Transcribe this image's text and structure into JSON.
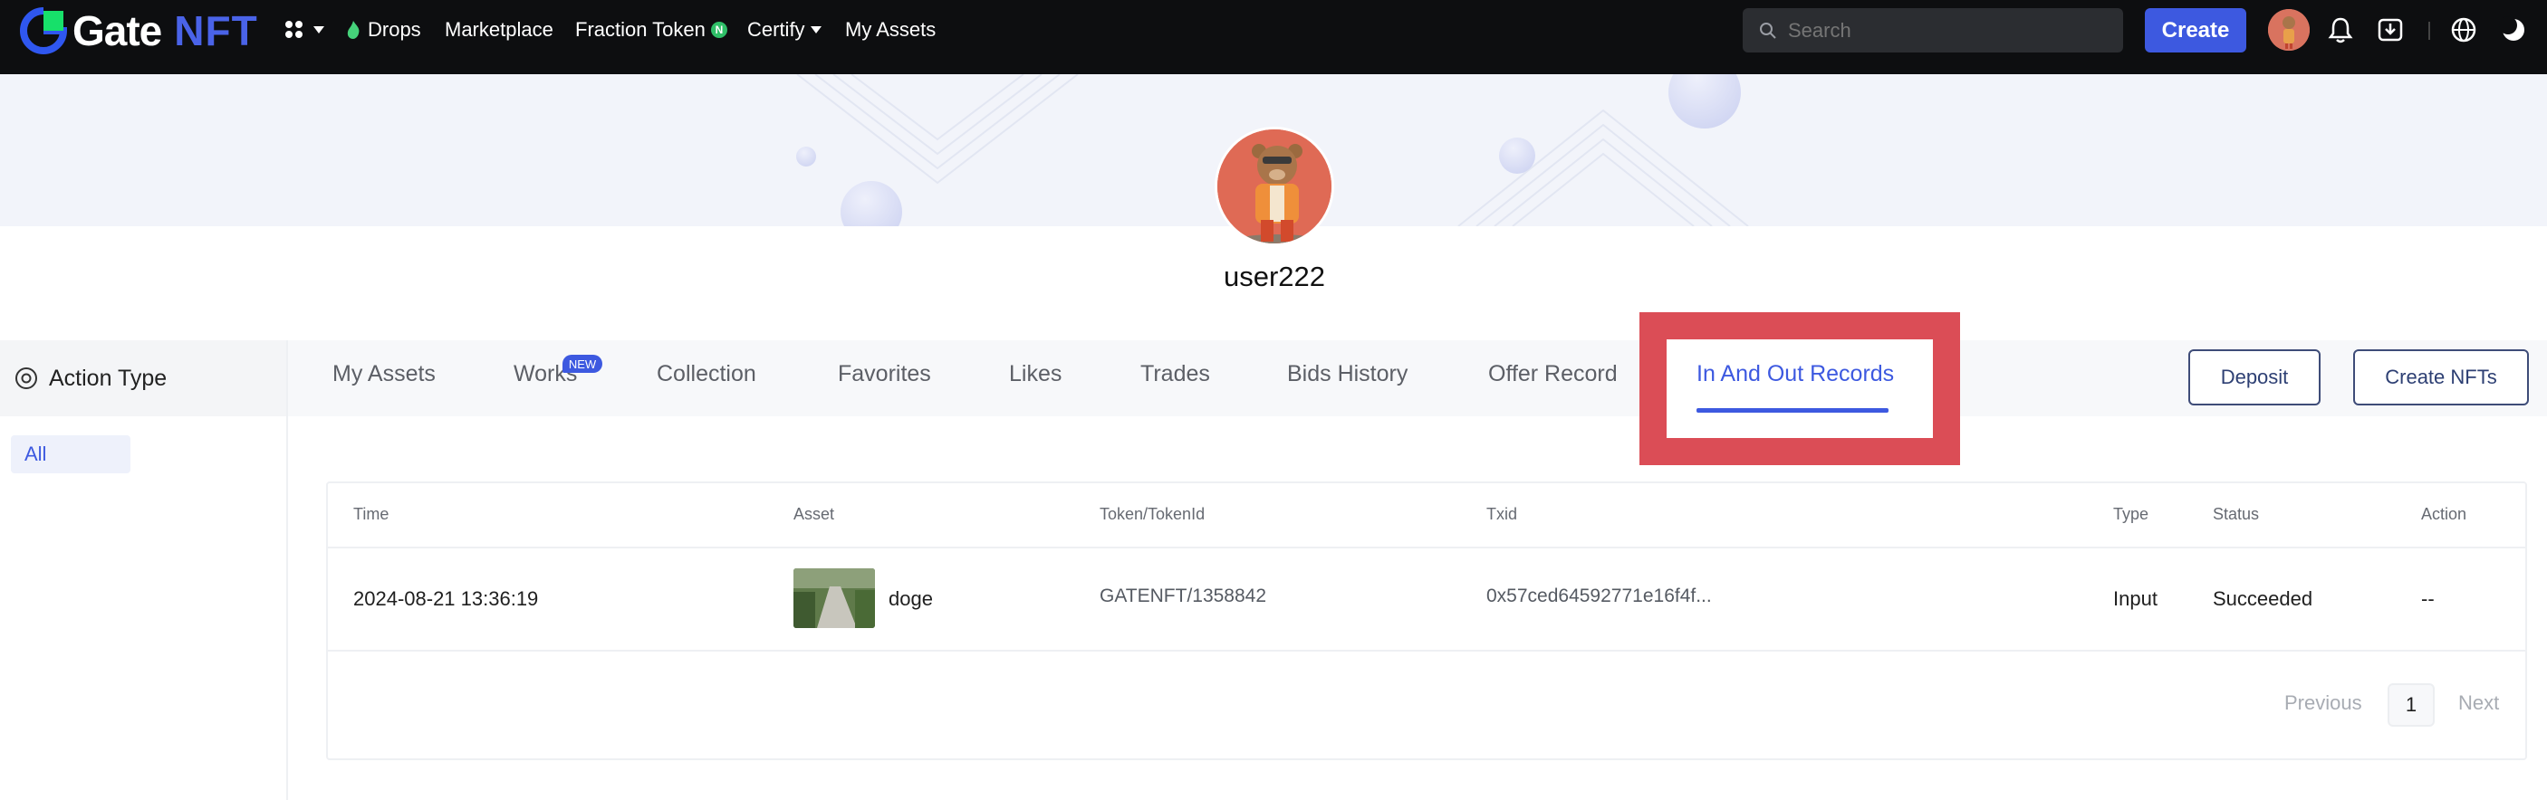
{
  "brand": {
    "name_part1": "Gate",
    "name_part2": "NFT"
  },
  "nav": {
    "drops": "Drops",
    "marketplace": "Marketplace",
    "fraction_token": "Fraction Token",
    "fraction_badge": "N",
    "certify": "Certify",
    "my_assets": "My Assets"
  },
  "search": {
    "placeholder": "Search"
  },
  "header": {
    "create_label": "Create"
  },
  "profile": {
    "username": "user222"
  },
  "sidebar": {
    "title": "Action Type",
    "items": [
      {
        "label": "All",
        "selected": true
      }
    ]
  },
  "tabs": [
    {
      "label": "My Assets"
    },
    {
      "label": "Works",
      "badge": "NEW"
    },
    {
      "label": "Collection"
    },
    {
      "label": "Favorites"
    },
    {
      "label": "Likes"
    },
    {
      "label": "Trades"
    },
    {
      "label": "Bids History"
    },
    {
      "label": "Offer Record"
    },
    {
      "label": "In And Out Records",
      "active": true
    }
  ],
  "actions": {
    "deposit": "Deposit",
    "create_nfts": "Create NFTs"
  },
  "table": {
    "columns": [
      "Time",
      "Asset",
      "Token/TokenId",
      "Txid",
      "Type",
      "Status",
      "Action"
    ],
    "rows": [
      {
        "time": "2024-08-21 13:36:19",
        "asset": "doge",
        "token": "GATENFT/1358842",
        "txid": "0x57ced64592771e16f4f...",
        "type": "Input",
        "status": "Succeeded",
        "action": "--"
      }
    ]
  },
  "pagination": {
    "previous": "Previous",
    "current": "1",
    "next": "Next"
  },
  "colors": {
    "accent": "#3d59e0",
    "topbar": "#0d0e10",
    "highlight": "#db4d56"
  }
}
